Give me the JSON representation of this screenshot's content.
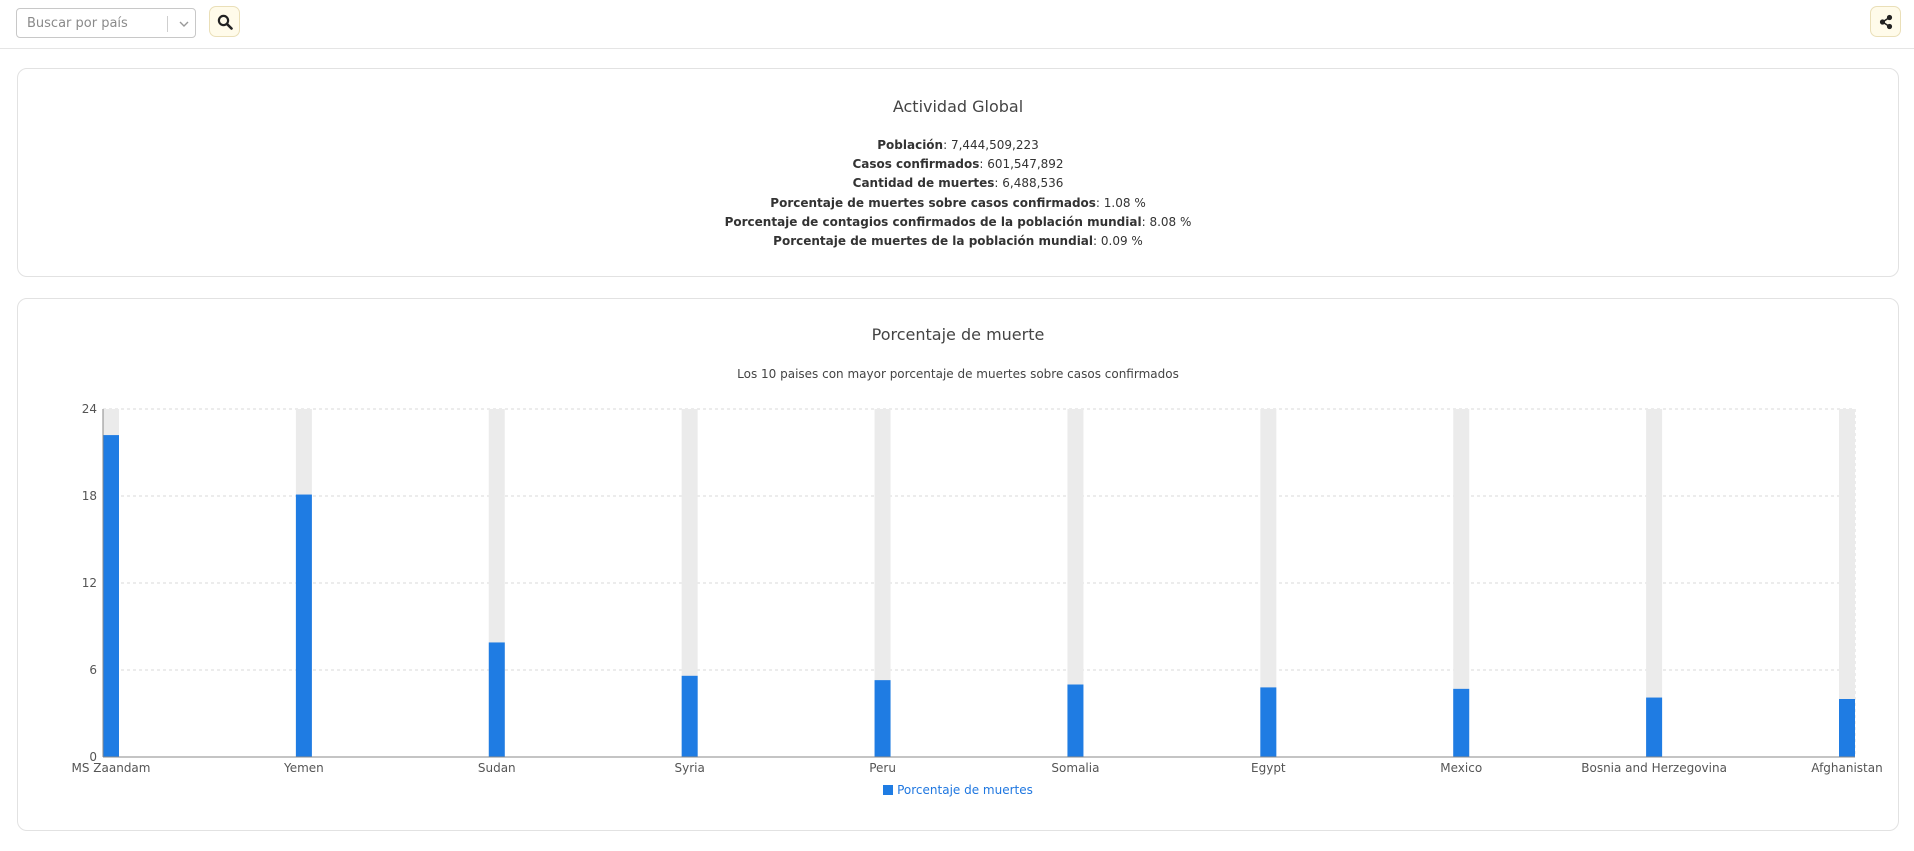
{
  "search": {
    "placeholder": "Buscar por país"
  },
  "icons": {
    "search": "search-icon",
    "share": "share-icon",
    "dropdown": "chevron-down-icon"
  },
  "colors": {
    "bar": "#1f7ce3",
    "bar_track": "#ebebeb",
    "accent_button_bg": "#fffbea"
  },
  "global": {
    "title": "Actividad Global",
    "stats": [
      {
        "label": "Población",
        "value": ": 7,444,509,223"
      },
      {
        "label": "Casos confirmados",
        "value": ": 601,547,892"
      },
      {
        "label": "Cantidad de muertes",
        "value": ": 6,488,536"
      },
      {
        "label": "Porcentaje de muertes sobre casos confirmados",
        "value": ": 1.08 %"
      },
      {
        "label": "Porcentaje de contagios confirmados de la población mundial",
        "value": ": 8.08 %"
      },
      {
        "label": "Porcentaje de muertes de la población mundial",
        "value": ": 0.09 %"
      }
    ]
  },
  "mortality": {
    "title": "Porcentaje de muerte",
    "subtitle": "Los 10 paises con mayor porcentaje de muertes sobre casos confirmados"
  },
  "chart_data": {
    "type": "bar",
    "categories": [
      "MS Zaandam",
      "Yemen",
      "Sudan",
      "Syria",
      "Peru",
      "Somalia",
      "Egypt",
      "Mexico",
      "Bosnia and Herzegovina",
      "Afghanistan"
    ],
    "series": [
      {
        "name": "Porcentaje de muertes",
        "values": [
          22.2,
          18.1,
          7.9,
          5.6,
          5.3,
          5.0,
          4.8,
          4.7,
          4.1,
          4.0
        ]
      }
    ],
    "yticks": [
      "0",
      "6",
      "12",
      "18",
      "24"
    ],
    "ylim": [
      0,
      24
    ],
    "grid": true,
    "legend_position": "bottom-center"
  }
}
